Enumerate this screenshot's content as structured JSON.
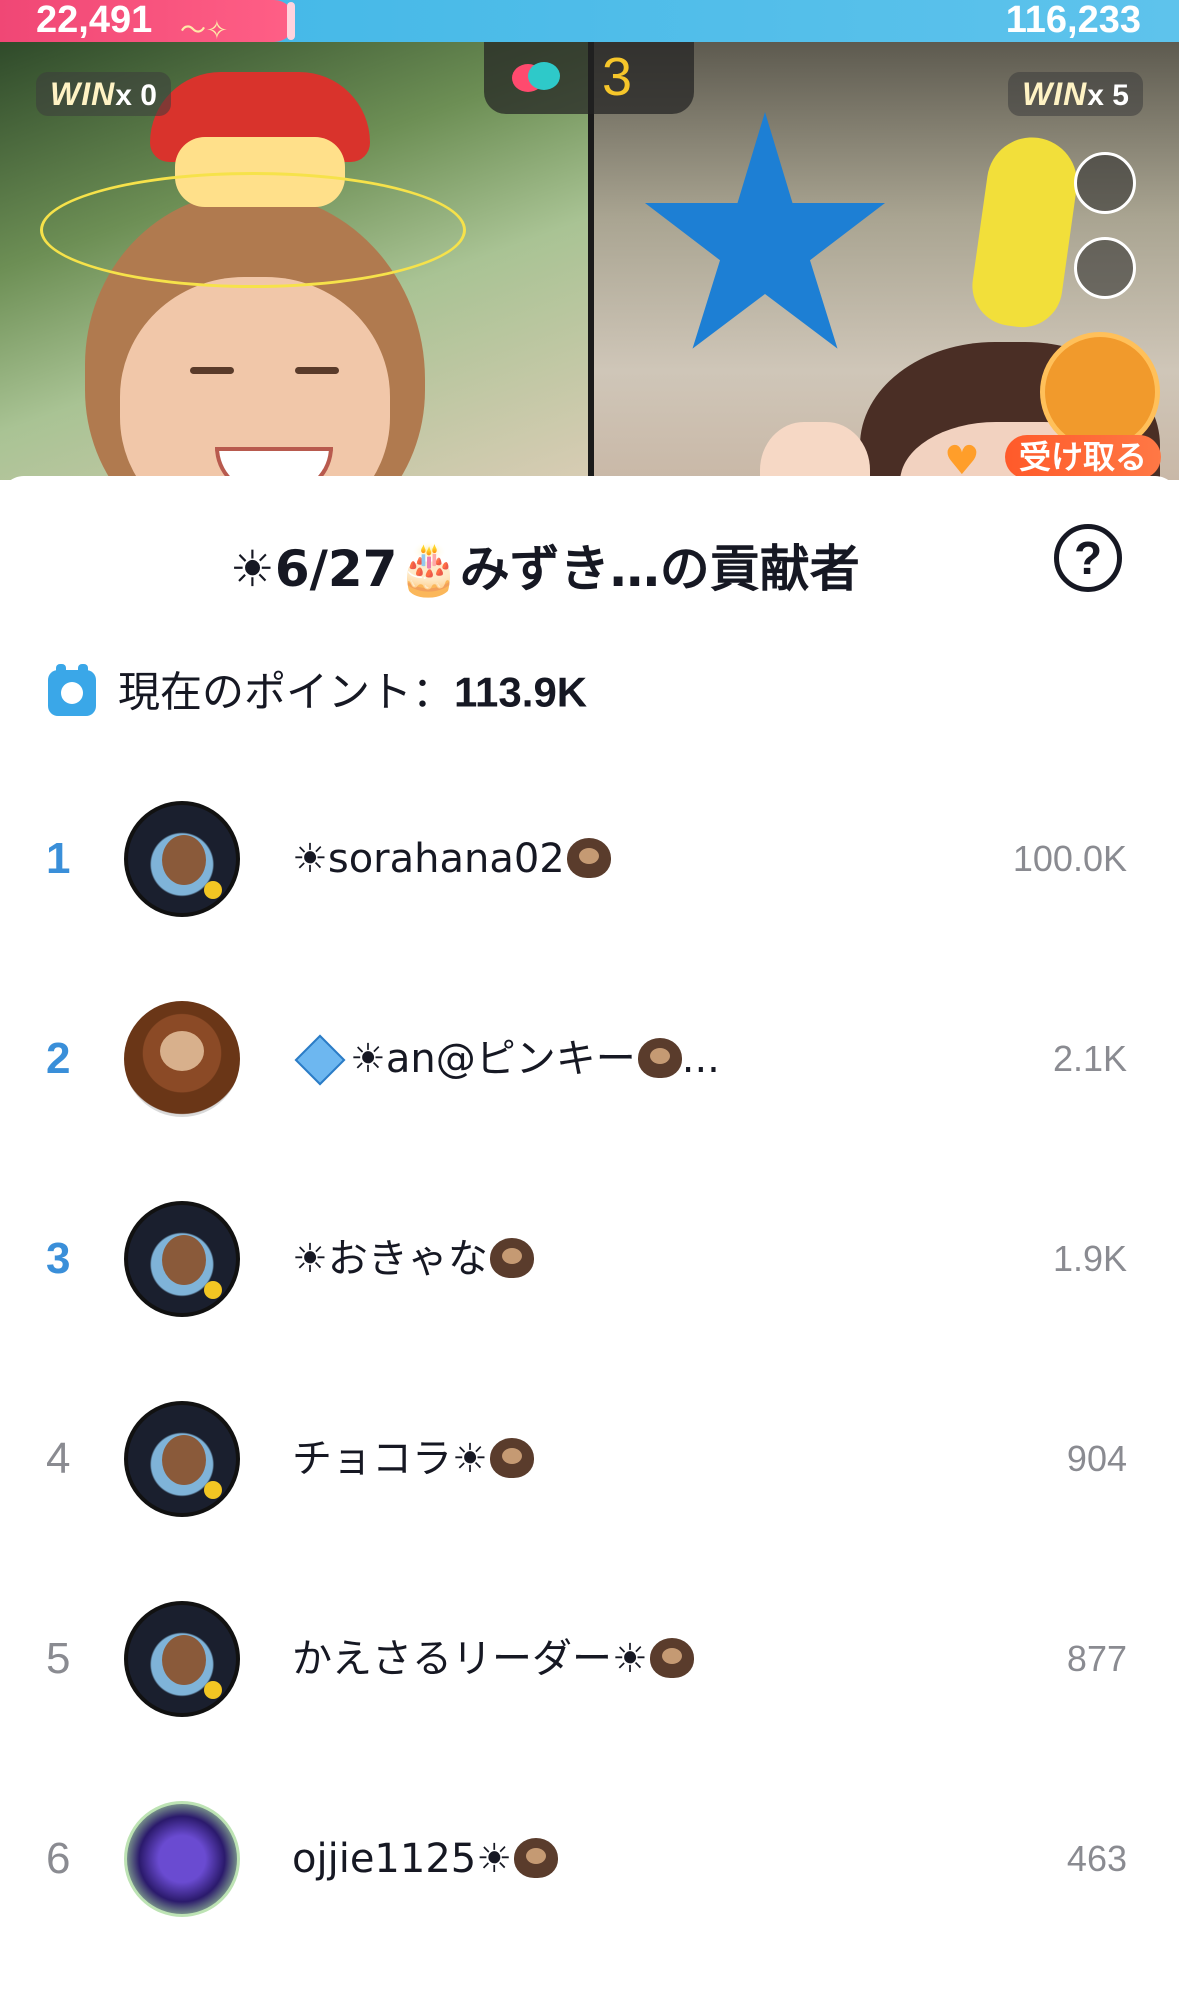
{
  "battle": {
    "left_score": "22,491",
    "right_score": "116,233",
    "left_wins_label": "WIN",
    "left_wins_count": "x 0",
    "right_wins_label": "WIN",
    "right_wins_count": "x 5",
    "round": "3",
    "claim_label": "受け取る"
  },
  "sheet": {
    "title": "☀6/27🎂みずき…の貢献者",
    "help_glyph": "?",
    "points_label": "現在のポイント：",
    "points_value": "113.9K"
  },
  "contributors": [
    {
      "rank": "1",
      "name": "☀sorahana02",
      "badges": [
        "sloth"
      ],
      "score": "100.0K",
      "avatar": "style-a",
      "highlight": true
    },
    {
      "rank": "2",
      "name": "☀an@ピンキー",
      "badges": [
        "diamond",
        "sloth"
      ],
      "suffix": "...",
      "score": "2.1K",
      "avatar": "style-b",
      "highlight": true
    },
    {
      "rank": "3",
      "name": "☀おきゃな",
      "badges": [
        "sloth"
      ],
      "score": "1.9K",
      "avatar": "style-a",
      "highlight": true
    },
    {
      "rank": "4",
      "name": "チョコラ☀",
      "badges": [
        "sloth"
      ],
      "score": "904",
      "avatar": "style-a",
      "highlight": false
    },
    {
      "rank": "5",
      "name": "かえさるリーダー☀",
      "badges": [
        "sloth"
      ],
      "score": "877",
      "avatar": "style-a",
      "highlight": false
    },
    {
      "rank": "6",
      "name": "ojjie1125☀",
      "badges": [
        "sloth"
      ],
      "score": "463",
      "avatar": "style-c",
      "highlight": false
    }
  ],
  "colors": {
    "left_team": "#f04775",
    "right_team": "#3fb6e6",
    "top_rank": "#3a8fd9",
    "muted": "#8a8b91",
    "claim": "#ff5a2a"
  }
}
